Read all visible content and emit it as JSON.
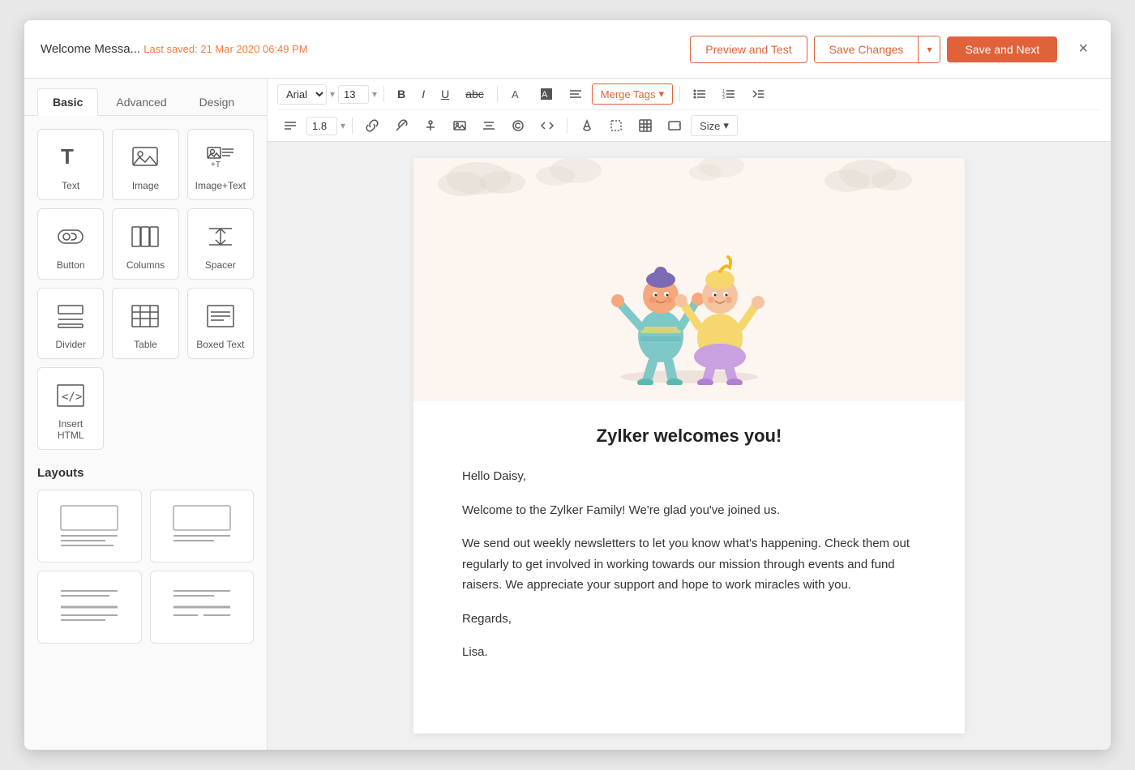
{
  "window": {
    "title": "Welcome Messa...",
    "saved_text": "Last saved: 21 Mar 2020 06:49 PM",
    "close_label": "×"
  },
  "header": {
    "preview_btn": "Preview and Test",
    "save_changes_btn": "Save Changes",
    "save_next_btn": "Save and Next"
  },
  "sidebar": {
    "tabs": [
      {
        "id": "basic",
        "label": "Basic",
        "active": true
      },
      {
        "id": "advanced",
        "label": "Advanced",
        "active": false
      },
      {
        "id": "design",
        "label": "Design",
        "active": false
      }
    ],
    "elements": [
      {
        "id": "text",
        "label": "Text",
        "icon": "text-icon"
      },
      {
        "id": "image",
        "label": "Image",
        "icon": "image-icon"
      },
      {
        "id": "image-text",
        "label": "Image+Text",
        "icon": "image-text-icon"
      },
      {
        "id": "button",
        "label": "Button",
        "icon": "button-icon"
      },
      {
        "id": "columns",
        "label": "Columns",
        "icon": "columns-icon"
      },
      {
        "id": "spacer",
        "label": "Spacer",
        "icon": "spacer-icon"
      },
      {
        "id": "divider",
        "label": "Divider",
        "icon": "divider-icon"
      },
      {
        "id": "table",
        "label": "Table",
        "icon": "table-icon"
      },
      {
        "id": "boxed-text",
        "label": "Boxed Text",
        "icon": "boxed-text-icon"
      },
      {
        "id": "insert-html",
        "label": "Insert HTML",
        "icon": "html-icon"
      }
    ],
    "layouts_title": "Layouts",
    "layouts": [
      {
        "id": "layout1",
        "type": "image-text"
      },
      {
        "id": "layout2",
        "type": "image-text-alt"
      },
      {
        "id": "layout3",
        "type": "two-col"
      },
      {
        "id": "layout4",
        "type": "two-col-alt"
      }
    ]
  },
  "toolbar": {
    "font_family": "Arial",
    "font_size": "13",
    "line_height": "1.8",
    "merge_tags_label": "Merge Tags",
    "size_label": "Size"
  },
  "email": {
    "heading": "Zylker welcomes you!",
    "greeting": "Hello Daisy,",
    "para1": "Welcome to the Zylker Family! We're glad you've joined us.",
    "para2": "We send out weekly newsletters to let you know what's happening. Check them out regularly to get involved in working towards our mission through events and fund raisers. We appreciate your support and hope to work miracles with you.",
    "closing": "Regards,",
    "signoff": "Lisa."
  }
}
